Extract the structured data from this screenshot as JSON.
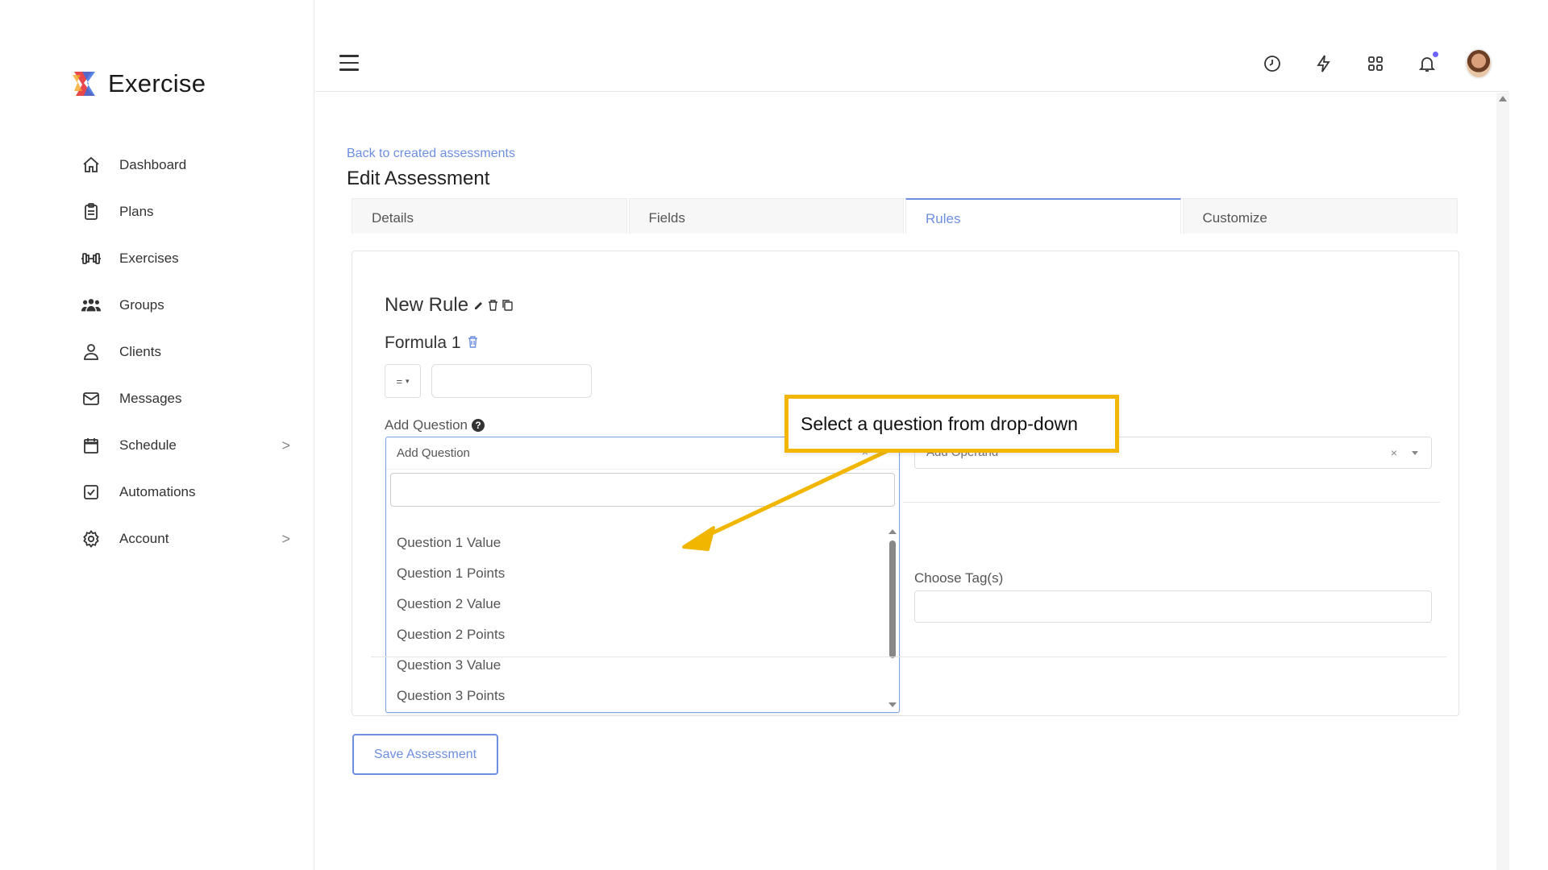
{
  "brand": {
    "title": "Exercise"
  },
  "sidebar": {
    "items": [
      {
        "label": "Dashboard",
        "icon": "home-icon"
      },
      {
        "label": "Plans",
        "icon": "clipboard-icon"
      },
      {
        "label": "Exercises",
        "icon": "dumbbell-icon"
      },
      {
        "label": "Groups",
        "icon": "users-icon"
      },
      {
        "label": "Clients",
        "icon": "user-icon"
      },
      {
        "label": "Messages",
        "icon": "mail-icon"
      },
      {
        "label": "Schedule",
        "icon": "calendar-icon",
        "chevron": ">"
      },
      {
        "label": "Automations",
        "icon": "checkbox-icon"
      },
      {
        "label": "Account",
        "icon": "gear-icon",
        "chevron": ">"
      }
    ]
  },
  "topbar": {
    "icons": [
      "clock-icon",
      "lightning-icon",
      "apps-grid-icon",
      "bell-icon",
      "avatar"
    ],
    "accent": "#6c63ff"
  },
  "main": {
    "back_link": "Back to created assessments",
    "title": "Edit Assessment",
    "tabs": [
      {
        "label": "Details",
        "active": false
      },
      {
        "label": "Fields",
        "active": false
      },
      {
        "label": "Rules",
        "active": true
      },
      {
        "label": "Customize",
        "active": false
      }
    ]
  },
  "rule": {
    "title": "New Rule",
    "formula_title": "Formula 1",
    "operator_value": "=",
    "add_question_label": "Add Question",
    "help_glyph": "?"
  },
  "dropdown": {
    "placeholder": "Add Question",
    "clear": "×",
    "options": [
      "Question 1 Value",
      "Question 1 Points",
      "Question 2 Value",
      "Question 2 Points",
      "Question 3 Value",
      "Question 3 Points"
    ]
  },
  "operand": {
    "placeholder": "Add Operand",
    "clear": "×"
  },
  "tags": {
    "label": "Choose Tag(s)"
  },
  "save_button": "Save Assessment",
  "annotation": {
    "text": "Select a question from drop-down",
    "color": "#f1b700"
  },
  "colors": {
    "link": "#6d8fe0",
    "border": "#e3e3e3"
  }
}
